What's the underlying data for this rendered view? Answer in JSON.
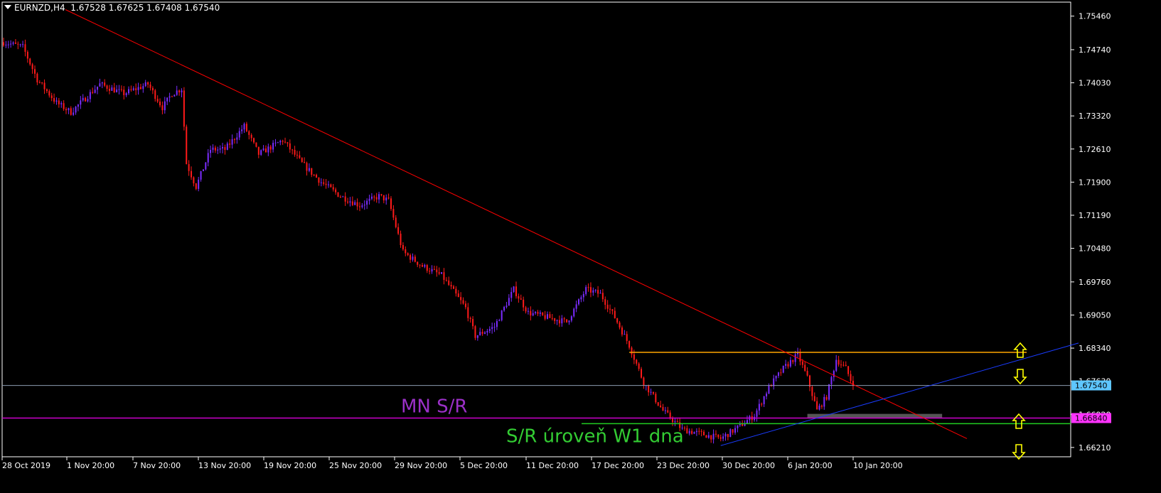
{
  "header": {
    "symbol": "EURNZD,H4",
    "ohlc": "1.67528 1.67625 1.67408 1.67540"
  },
  "colors": {
    "background": "#000000",
    "frame": "#ffffff",
    "bull": "#7b2cff",
    "bear": "#ff1a1a",
    "downtrend": "#ff0000",
    "uptrend": "#1a3cff",
    "orange_level": "#ffa500",
    "magenta_level": "#cc00cc",
    "green_level": "#22cc22",
    "price_line": "#8c9bb0",
    "price_label_bg": "#5ec6ff",
    "magenta_label_bg": "#ff33ff",
    "gray_zone": "#555555",
    "arrow": "#ffff00",
    "mn_text": "#9b30c8",
    "w1_text": "#33cc33"
  },
  "annotations": {
    "mn_label": "MN S/R",
    "w1_label": "S/R úroveň W1 dna",
    "arrows": [
      "up-arrow-icon",
      "down-arrow-icon",
      "up-arrow-icon",
      "down-arrow-icon"
    ]
  },
  "chart_data": {
    "type": "candlestick",
    "symbol": "EURNZD",
    "timeframe": "H4",
    "y_ticks": [
      "1.75460",
      "1.74740",
      "1.74030",
      "1.73320",
      "1.72610",
      "1.71900",
      "1.71190",
      "1.70480",
      "1.69760",
      "1.69050",
      "1.68340",
      "1.67630",
      "1.66920",
      "1.66210"
    ],
    "ylim": [
      1.6601,
      1.7576
    ],
    "x_ticks": [
      "28 Oct 2019",
      "1 Nov 20:00",
      "7 Nov 20:00",
      "13 Nov 20:00",
      "19 Nov 20:00",
      "25 Nov 20:00",
      "29 Nov 20:00",
      "5 Dec 20:00",
      "11 Dec 20:00",
      "17 Dec 20:00",
      "23 Dec 20:00",
      "30 Dec 20:00",
      "6 Jan 20:00",
      "10 Jan 20:00"
    ],
    "current_price": "1.67540",
    "level_label": "1.66840",
    "levels": {
      "orange": 1.6825,
      "magenta": 1.6684,
      "green": 1.6672
    },
    "close_anchors": [
      {
        "bar": 0,
        "close": 1.749
      },
      {
        "bar": 8,
        "close": 1.748
      },
      {
        "bar": 14,
        "close": 1.741
      },
      {
        "bar": 22,
        "close": 1.736
      },
      {
        "bar": 28,
        "close": 1.734
      },
      {
        "bar": 40,
        "close": 1.74
      },
      {
        "bar": 50,
        "close": 1.738
      },
      {
        "bar": 60,
        "close": 1.74
      },
      {
        "bar": 66,
        "close": 1.735
      },
      {
        "bar": 70,
        "close": 1.738
      },
      {
        "bar": 74,
        "close": 1.739
      },
      {
        "bar": 76,
        "close": 1.723
      },
      {
        "bar": 80,
        "close": 1.718
      },
      {
        "bar": 86,
        "close": 1.726
      },
      {
        "bar": 92,
        "close": 1.726
      },
      {
        "bar": 100,
        "close": 1.731
      },
      {
        "bar": 106,
        "close": 1.725
      },
      {
        "bar": 116,
        "close": 1.728
      },
      {
        "bar": 124,
        "close": 1.723
      },
      {
        "bar": 132,
        "close": 1.719
      },
      {
        "bar": 140,
        "close": 1.716
      },
      {
        "bar": 148,
        "close": 1.714
      },
      {
        "bar": 156,
        "close": 1.716
      },
      {
        "bar": 160,
        "close": 1.715
      },
      {
        "bar": 166,
        "close": 1.704
      },
      {
        "bar": 174,
        "close": 1.701
      },
      {
        "bar": 182,
        "close": 1.699
      },
      {
        "bar": 192,
        "close": 1.692
      },
      {
        "bar": 196,
        "close": 1.686
      },
      {
        "bar": 204,
        "close": 1.688
      },
      {
        "bar": 212,
        "close": 1.696
      },
      {
        "bar": 218,
        "close": 1.691
      },
      {
        "bar": 226,
        "close": 1.69
      },
      {
        "bar": 234,
        "close": 1.689
      },
      {
        "bar": 242,
        "close": 1.696
      },
      {
        "bar": 248,
        "close": 1.695
      },
      {
        "bar": 254,
        "close": 1.69
      },
      {
        "bar": 260,
        "close": 1.684
      },
      {
        "bar": 266,
        "close": 1.676
      },
      {
        "bar": 274,
        "close": 1.67
      },
      {
        "bar": 282,
        "close": 1.666
      },
      {
        "bar": 290,
        "close": 1.665
      },
      {
        "bar": 298,
        "close": 1.664
      },
      {
        "bar": 304,
        "close": 1.666
      },
      {
        "bar": 312,
        "close": 1.669
      },
      {
        "bar": 318,
        "close": 1.675
      },
      {
        "bar": 324,
        "close": 1.679
      },
      {
        "bar": 330,
        "close": 1.682
      },
      {
        "bar": 334,
        "close": 1.677
      },
      {
        "bar": 338,
        "close": 1.67
      },
      {
        "bar": 342,
        "close": 1.673
      },
      {
        "bar": 346,
        "close": 1.681
      },
      {
        "bar": 350,
        "close": 1.679
      },
      {
        "bar": 353,
        "close": 1.6754
      }
    ],
    "downtrend_line": [
      [
        0,
        1.756
      ],
      [
        380,
        1.664
      ]
    ],
    "uptrend_line": [
      [
        298,
        1.6625
      ],
      [
        424,
        1.6845
      ]
    ],
    "gray_zone": {
      "from_bar": 334,
      "to_bar": 390,
      "top": 1.6693,
      "bottom": 1.6684
    }
  }
}
